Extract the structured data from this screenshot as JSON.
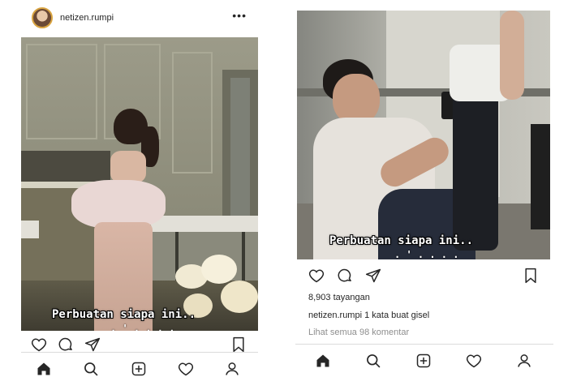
{
  "left": {
    "username": "netizen.rumpi",
    "more_label": "•••",
    "caption": "Perbuatan siapa ini.."
  },
  "right": {
    "caption": "Perbuatan siapa ini..",
    "views": "8,903 tayangan",
    "post_author": "netizen.rumpi",
    "post_text": " 1 kata buat gisel",
    "comments_link": "Lihat semua 98 komentar"
  },
  "icons": {
    "actions": [
      "heart-icon",
      "comment-icon",
      "share-icon",
      "bookmark-icon"
    ],
    "nav": [
      "home-icon",
      "search-icon",
      "add-post-icon",
      "activity-heart-icon",
      "profile-icon"
    ]
  },
  "colors": {
    "text": "#262626",
    "muted": "#8e8e8e",
    "divider": "#dbdbdb",
    "avatar_ring": "#d9a441"
  }
}
